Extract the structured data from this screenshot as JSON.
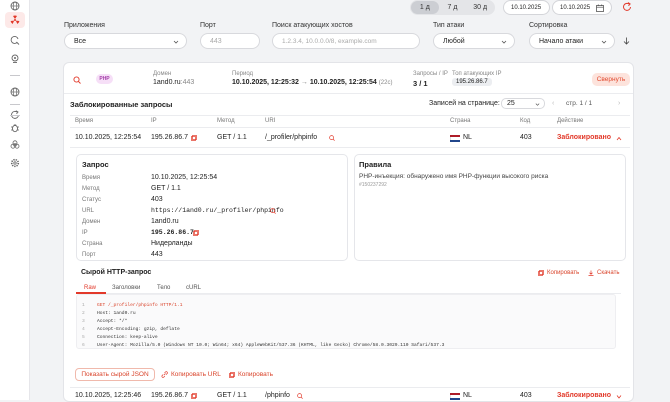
{
  "colors": {
    "accent": "#e2392a",
    "badge_bg": "#f6dff7",
    "badge_fg": "#a33ca8"
  },
  "sidebar": {
    "icons": [
      "globe-icon",
      "radiation-icon",
      "refresh-search-icon",
      "pin-icon",
      "globe-icon",
      "refresh-icon",
      "bug-icon",
      "biohazard-icon",
      "settings-icon"
    ]
  },
  "period": {
    "options": [
      "1 д",
      "7 д",
      "30 д"
    ],
    "selected": "1 д",
    "date_from": "10.10.2025",
    "date_to": "10.10.2025"
  },
  "filters": {
    "apps": {
      "label": "Приложения",
      "value": "Все"
    },
    "port": {
      "label": "Порт",
      "placeholder": "443"
    },
    "hosts": {
      "label": "Поиск атакующих хостов",
      "placeholder": "1.2.3.4, 10.0.0.0/8, example.com"
    },
    "attack_type": {
      "label": "Тип атаки",
      "value": "Любой"
    },
    "sort": {
      "label": "Сортировка",
      "value": "Начало атаки"
    }
  },
  "incident": {
    "badge": "PHP",
    "domain_label": "Домен",
    "domain": "1and0.ru",
    "domain_port": ":443",
    "period_label": "Период",
    "period_from": "10.10.2025, 12:25:32",
    "arrow": "→",
    "period_to": "10.10.2025, 12:25:54",
    "duration": "(22с)",
    "requests_label": "Запросы / IP",
    "requests": "3 / 1",
    "top_ip_label": "Топ атакующих IP",
    "top_ip": "195.26.86.7",
    "collapse": "Свернуть"
  },
  "blocked": {
    "title": "Заблокированные запросы",
    "per_page_label": "Записей на странице:",
    "per_page": "25",
    "page": "стр. 1 / 1",
    "columns": [
      "Время",
      "IP",
      "Метод",
      "URI",
      "Страна",
      "Код",
      "Действие"
    ],
    "rows": [
      {
        "time": "10.10.2025, 12:25:54",
        "ip": "195.26.86.7",
        "method": "GET / 1.1",
        "uri": "/_profiler/phpinfo",
        "country": "NL",
        "code": "403",
        "action": "Заблокировано"
      },
      {
        "time": "10.10.2025, 12:25:46",
        "ip": "195.26.86.7",
        "method": "GET / 1.1",
        "uri": "/phpinfo",
        "country": "NL",
        "code": "403",
        "action": "Заблокировано"
      }
    ]
  },
  "detail": {
    "req_title": "Запрос",
    "fields": [
      {
        "k": "Время",
        "v": "10.10.2025, 12:25:54"
      },
      {
        "k": "Метод",
        "v": "GET / 1.1"
      },
      {
        "k": "Статус",
        "v": "403"
      },
      {
        "k": "URL",
        "v": "https://1and0.ru/_profiler/phpinfo"
      },
      {
        "k": "Домен",
        "v": "1and0.ru"
      },
      {
        "k": "IP",
        "v": "195.26.86.7"
      },
      {
        "k": "Страна",
        "v": "Нидерланды"
      },
      {
        "k": "Порт",
        "v": "443"
      }
    ],
    "rules_title": "Правила",
    "rule_text": "PHP-инъекция: обнаружено имя PHP-функции высокого риска",
    "rule_id": "#150237292",
    "raw_title": "Сырой HTTP-запрос",
    "copy": "Копировать",
    "download": "Скачать",
    "tabs": [
      "Raw",
      "Заголовки",
      "Тело",
      "cURL"
    ],
    "code": [
      "GET /_profiler/phpinfo HTTP/1.1",
      "Host: 1and0.ru",
      "Accept: */*",
      "Accept-Encoding: gzip, deflate",
      "Connection: keep-alive",
      "User-Agent: Mozilla/5.0 (Windows NT 10.0; Win64; x64) AppleWebKit/537.36 (KHTML, like Gecko) Chrome/58.0.3029.110 Safari/537.3",
      ""
    ],
    "show_json": "Показать сырой JSON",
    "copy_url": "Копировать URL",
    "copy2": "Копировать"
  }
}
